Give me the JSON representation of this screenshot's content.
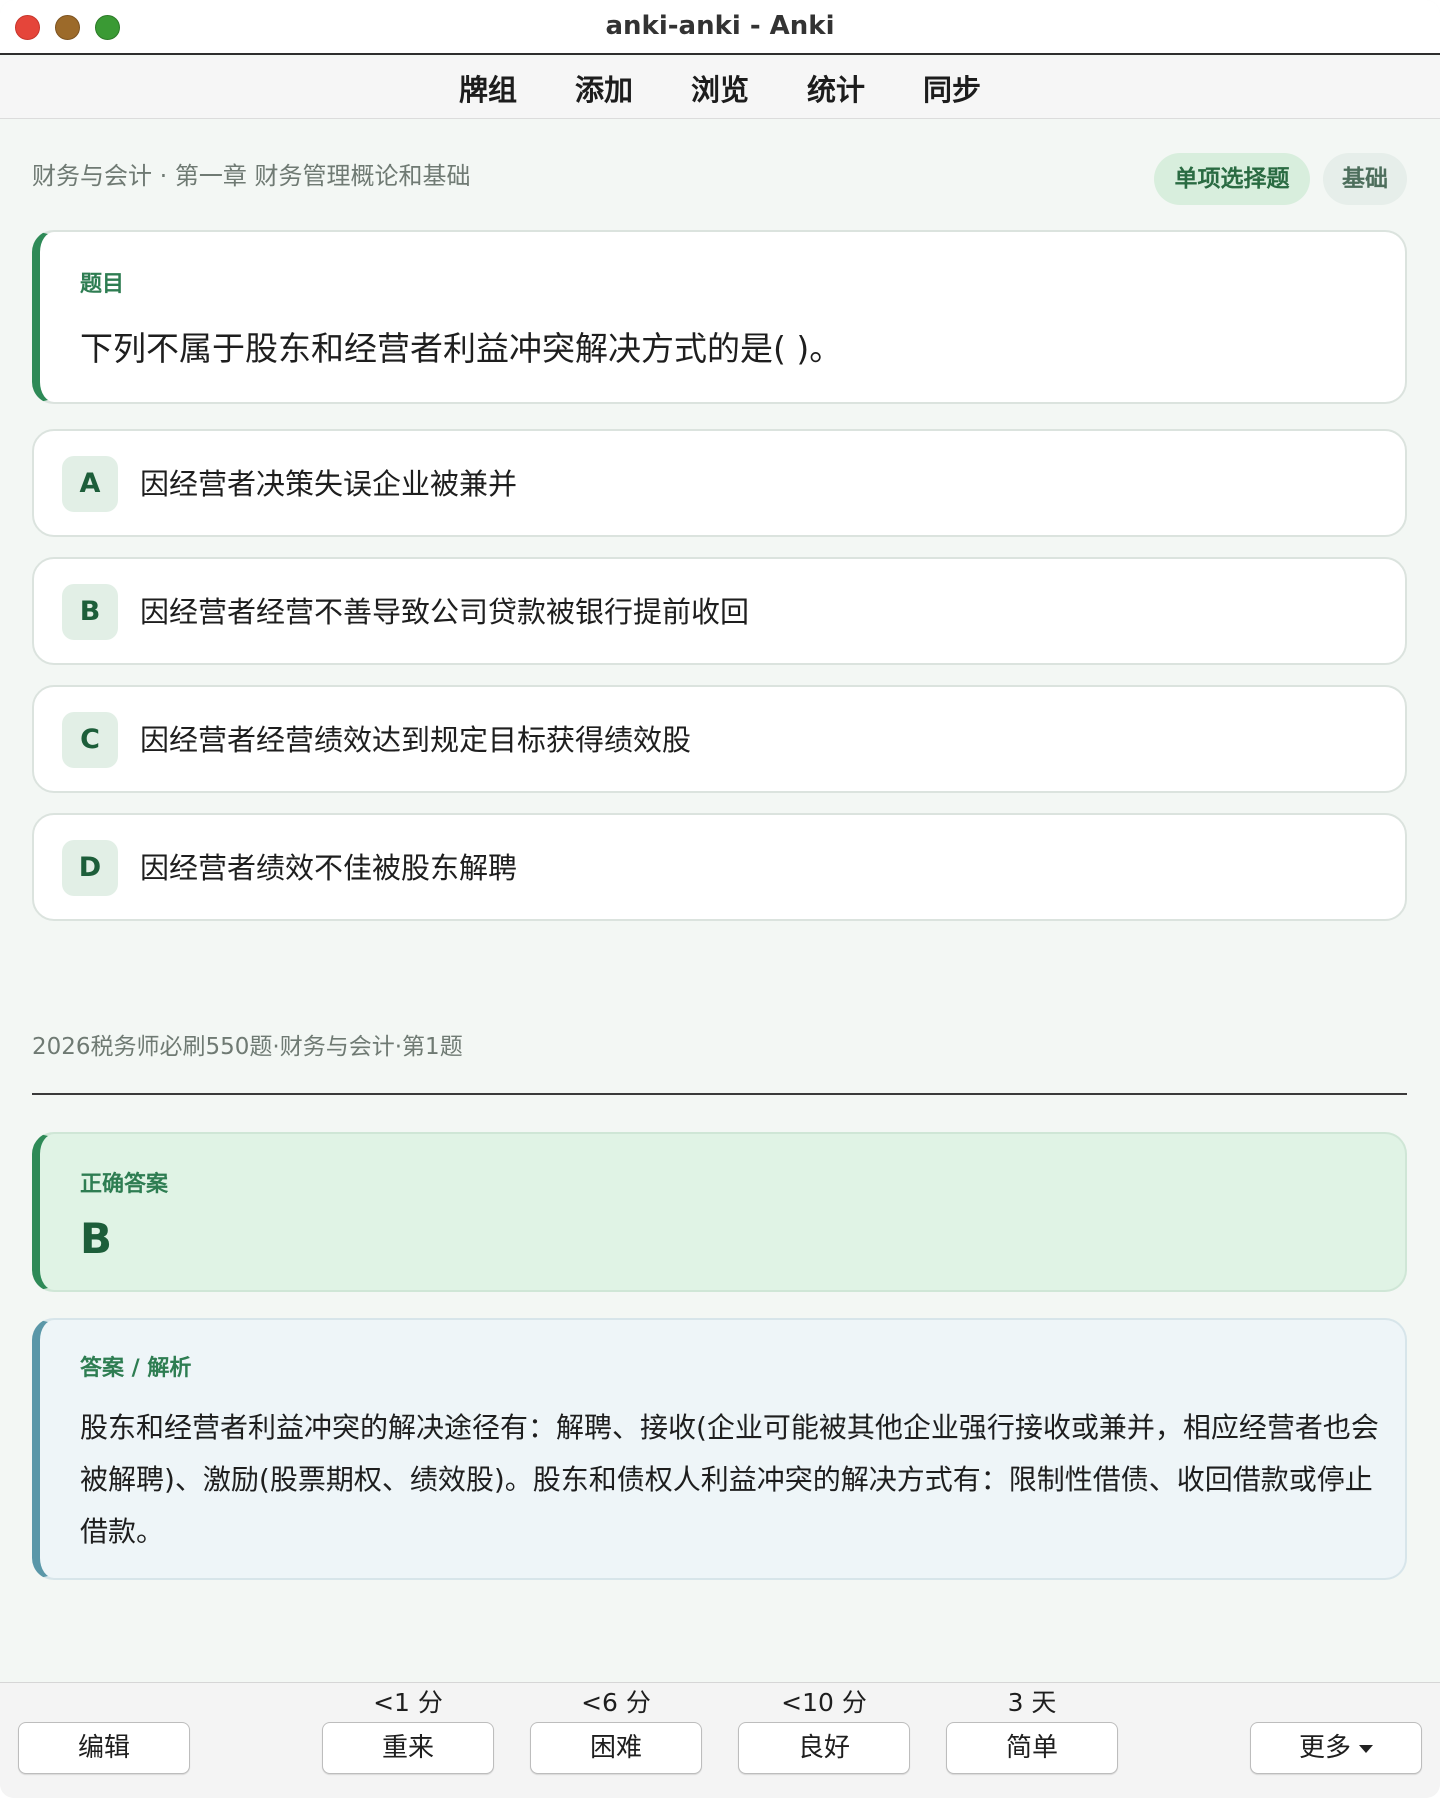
{
  "window": {
    "title": "anki-anki - Anki"
  },
  "nav": {
    "items": [
      "牌组",
      "添加",
      "浏览",
      "统计",
      "同步"
    ]
  },
  "card": {
    "breadcrumb": "财务与会计 · 第一章 财务管理概论和基础",
    "tags": {
      "type": "单项选择题",
      "level": "基础"
    },
    "question_label": "题目",
    "question": "下列不属于股东和经营者利益冲突解决方式的是( )。",
    "options": [
      {
        "letter": "A",
        "text": "因经营者决策失误企业被兼并"
      },
      {
        "letter": "B",
        "text": "因经营者经营不善导致公司贷款被银行提前收回"
      },
      {
        "letter": "C",
        "text": "因经营者经营绩效达到规定目标获得绩效股"
      },
      {
        "letter": "D",
        "text": "因经营者绩效不佳被股东解聘"
      }
    ],
    "source": "2026税务师必刷550题·财务与会计·第1题",
    "answer_label": "正确答案",
    "answer": "B",
    "explanation_label": "答案 / 解析",
    "explanation": "股东和经营者利益冲突的解决途径有：解聘、接收(企业可能被其他企业强行接收或兼并，相应经营者也会被解聘)、激励(股票期权、绩效股)。股东和债权人利益冲突的解决方式有：限制性借债、收回借款或停止借款。"
  },
  "bottom": {
    "edit_label": "编辑",
    "more_label": "更多",
    "answers": [
      {
        "label": "重来",
        "interval": "<1 分"
      },
      {
        "label": "困难",
        "interval": "<6 分"
      },
      {
        "label": "良好",
        "interval": "<10 分"
      },
      {
        "label": "简单",
        "interval": "3 天"
      }
    ]
  },
  "colors": {
    "accent": "#2e8a57",
    "answer_bg": "#e0f3e5",
    "explain_bg": "#eef5f8",
    "explain_accent": "#5a97a8"
  }
}
